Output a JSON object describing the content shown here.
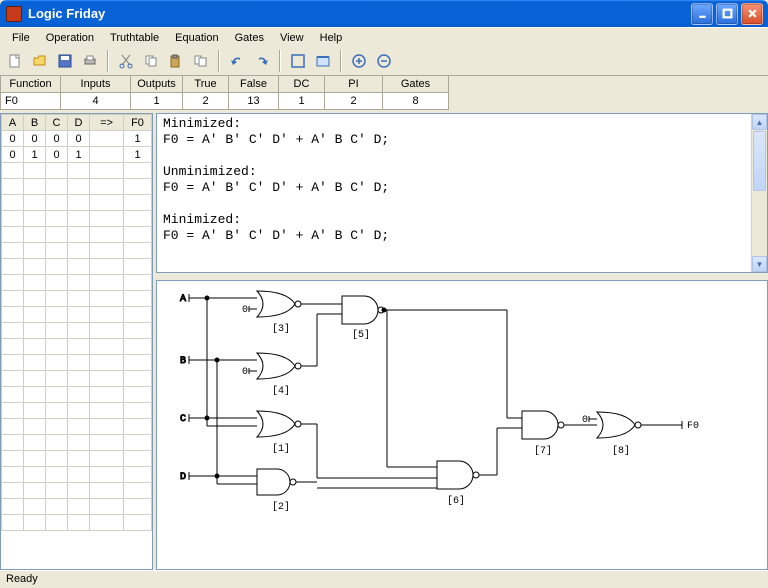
{
  "title": "Logic Friday",
  "menu": [
    "File",
    "Operation",
    "Truthtable",
    "Equation",
    "Gates",
    "View",
    "Help"
  ],
  "summary_headers": [
    "Function",
    "Inputs",
    "Outputs",
    "True",
    "False",
    "DC",
    "PI",
    "Gates"
  ],
  "summary_row": [
    "F0",
    "4",
    "1",
    "2",
    "13",
    "1",
    "2",
    "8"
  ],
  "truth_headers": [
    "A",
    "B",
    "C",
    "D",
    "=>",
    "F0"
  ],
  "truth_rows": [
    [
      "0",
      "0",
      "0",
      "0",
      "",
      "1"
    ],
    [
      "0",
      "1",
      "0",
      "1",
      "",
      "1"
    ]
  ],
  "equations": "Minimized:\nF0 = A' B' C' D' + A' B C' D;\n\nUnminimized:\nF0 = A' B' C' D' + A' B C' D;\n\nMinimized:\nF0 = A' B' C' D' + A' B C' D;",
  "gate_inputs": [
    "A",
    "B",
    "C",
    "D"
  ],
  "gate_labels": {
    "g1": "[1]",
    "g2": "[2]",
    "g3": "[3]",
    "g4": "[4]",
    "g5": "[5]",
    "g6": "[6]",
    "g7": "[7]",
    "g8": "[8]"
  },
  "output_name": "F0",
  "status": "Ready"
}
